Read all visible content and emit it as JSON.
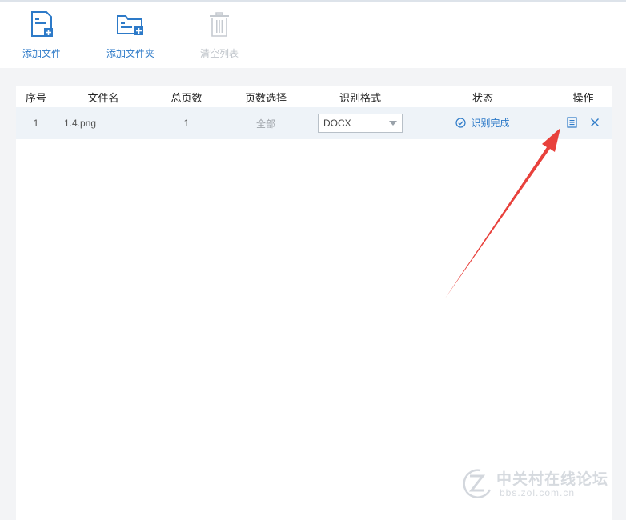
{
  "toolbar": {
    "add_file": {
      "label": "添加文件",
      "icon": "add-file-icon"
    },
    "add_folder": {
      "label": "添加文件夹",
      "icon": "add-folder-icon"
    },
    "clear_list": {
      "label": "清空列表",
      "icon": "trash-icon",
      "disabled": true
    }
  },
  "table": {
    "headers": {
      "index": "序号",
      "filename": "文件名",
      "total_pages": "总页数",
      "page_select": "页数选择",
      "format": "识别格式",
      "status": "状态",
      "actions": "操作"
    },
    "rows": [
      {
        "index": "1",
        "filename": "1.4.png",
        "total_pages": "1",
        "page_select": "全部",
        "format": "DOCX",
        "status": "识别完成",
        "status_icon": "check-circle-icon",
        "action_icons": [
          "document-icon",
          "close-icon"
        ]
      }
    ]
  },
  "watermark": {
    "text": "中关村在线论坛",
    "url": "bbs.zol.com.cn"
  },
  "colors": {
    "accent": "#2d7ac8",
    "row_bg": "#eef3f8",
    "page_bg": "#f3f4f6",
    "arrow": "#e8413c"
  }
}
